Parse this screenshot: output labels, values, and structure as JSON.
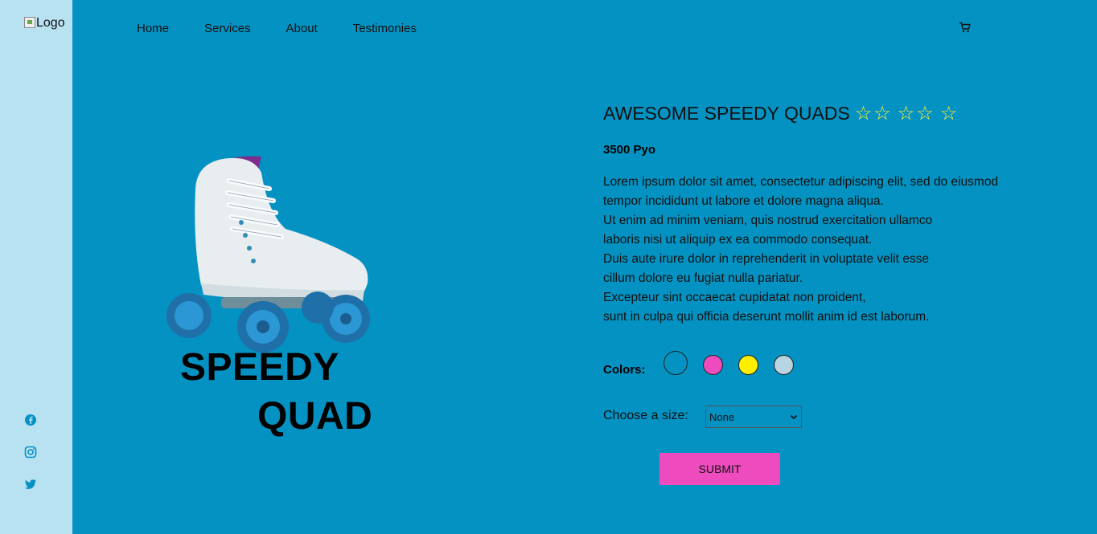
{
  "logo": {
    "alt": "Logo"
  },
  "nav": {
    "items": [
      "Home",
      "Services",
      "About",
      "Testimonies"
    ]
  },
  "brand": {
    "line1": "SPEEDY",
    "line2": "QUAD"
  },
  "product": {
    "title": "AWESOME SPEEDY QUADS",
    "rating": {
      "stars_shown": 5,
      "style": "outline"
    },
    "price": "3500 Pyo",
    "description_lines": [
      "Lorem ipsum dolor sit amet, consectetur adipiscing elit, sed do eiusmod",
      "tempor incididunt ut labore et dolore magna aliqua.",
      "Ut enim ad minim veniam, quis nostrud exercitation ullamco",
      "laboris nisi ut aliquip ex ea commodo consequat.",
      "Duis aute irure dolor in reprehenderit in voluptate velit esse",
      "cillum dolore eu fugiat nulla pariatur.",
      "Excepteur sint occaecat cupidatat non proident,",
      "sunt in culpa qui officia deserunt mollit anim id est laborum."
    ],
    "colors_label": "Colors:",
    "colors": [
      "#0492c2",
      "#ee4cbe",
      "#ffee00",
      "#b8d4e3"
    ],
    "size_label": "Choose a size:",
    "size_selected": "None",
    "submit_label": "SUBMIT"
  },
  "social": [
    "facebook-icon",
    "instagram-icon",
    "twitter-icon"
  ],
  "theme": {
    "background": "#0492c2",
    "sidebar": "#b8e2f2",
    "accent": "#ee4cbe",
    "star": "#ffee33"
  }
}
